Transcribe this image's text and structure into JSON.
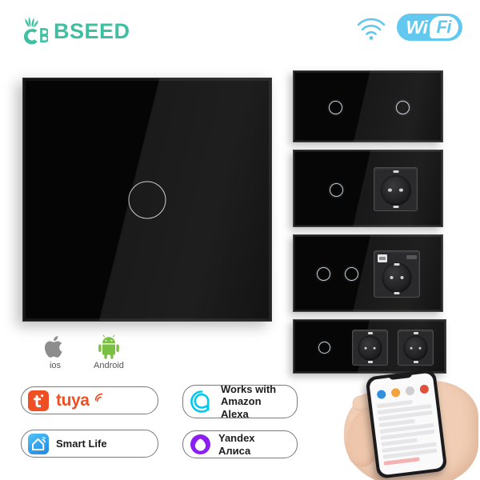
{
  "background_color": "#ffffff",
  "header": {
    "brand_name": "BSEED",
    "brand_color": "#3fbfa2",
    "brand_icon": "sprout-c-logo",
    "wifi_icon": "wifi-signal-icon",
    "wifi_badge": {
      "text_left": "Wi",
      "text_right": "Fi",
      "color": "#63c8f0"
    }
  },
  "hero": {
    "name": "black-glass-touch-switch-1-gang",
    "touch_buttons": 1,
    "panel_color": "#050505"
  },
  "variants": [
    {
      "name": "double-panel-2-touch",
      "touch_buttons": 2,
      "sockets": 0,
      "usb": false
    },
    {
      "name": "touch-plus-socket",
      "touch_buttons": 1,
      "sockets": 1,
      "usb": false
    },
    {
      "name": "two-touch-plus-usb-socket",
      "touch_buttons": 2,
      "sockets": 1,
      "usb": true
    },
    {
      "name": "touch-plus-double-socket",
      "touch_buttons": 1,
      "sockets": 2,
      "usb": false
    }
  ],
  "os_support": [
    {
      "label": "ios",
      "icon": "apple-logo",
      "color": "#8d8d8d"
    },
    {
      "label": "Android",
      "icon": "android-robot",
      "color": "#7bc043"
    }
  ],
  "badges": [
    {
      "id": "tuya",
      "label": "tuya",
      "icon": "tuya-tile-icon",
      "tile_color": "#f04e23",
      "text_color": "#f04e23"
    },
    {
      "id": "smartlife",
      "label": "Smart Life",
      "icon": "smart-life-house-icon",
      "tile_color": "#2196f3",
      "text_color": "#1c1c1c"
    },
    {
      "id": "alexa",
      "label_line1": "Works with",
      "label_line2": "Amazon Alexa",
      "icon": "alexa-ring-icon",
      "icon_color": "#00c8f0",
      "text_color": "#1c1c1c"
    },
    {
      "id": "yandex",
      "label": "Yandex Алиса",
      "icon": "yandex-alice-icon",
      "icon_color": "#8b1ef0",
      "text_color": "#1c1c1c"
    }
  ],
  "phone": {
    "name": "hand-holding-smartphone-app",
    "app_screen": "smart-home-app-device-list"
  }
}
